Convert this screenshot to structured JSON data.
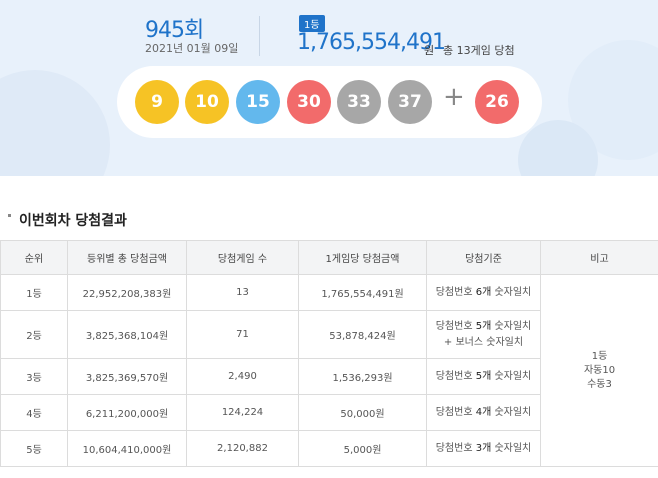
{
  "draw": {
    "round": "945회",
    "date": "2021년 01월 09일",
    "first_prize_badge": "1등",
    "first_prize_amount": "1,765,554,491",
    "first_prize_unit": "원",
    "winner_text": "총 13게임 당첨"
  },
  "balls": [
    {
      "number": "9",
      "color": "#f6c325"
    },
    {
      "number": "10",
      "color": "#f6c325"
    },
    {
      "number": "15",
      "color": "#63b8ed"
    },
    {
      "number": "30",
      "color": "#f26b6b"
    },
    {
      "number": "33",
      "color": "#a7a7a7"
    },
    {
      "number": "37",
      "color": "#a7a7a7"
    }
  ],
  "plus_sign": "+",
  "bonus_ball": {
    "number": "26",
    "color": "#f26b6b"
  },
  "section_title": "이번회차 당첨결과",
  "table": {
    "headers": [
      "순위",
      "등위별 총 당첨금액",
      "당첨게임 수",
      "1게임당 당첨금액",
      "당첨기준",
      "비고"
    ],
    "rows": [
      {
        "rank": "1등",
        "total": "22,952,208,383원",
        "games": "13",
        "per_game": "1,765,554,491원",
        "criteria_prefix": "당첨번호 ",
        "criteria_count": "6개",
        "criteria_suffix": " 숫자일치",
        "criteria_line2": ""
      },
      {
        "rank": "2등",
        "total": "3,825,368,104원",
        "games": "71",
        "per_game": "53,878,424원",
        "criteria_prefix": "당첨번호 ",
        "criteria_count": "5개",
        "criteria_suffix": " 숫자일치",
        "criteria_line2": "+ 보너스 숫자일치"
      },
      {
        "rank": "3등",
        "total": "3,825,369,570원",
        "games": "2,490",
        "per_game": "1,536,293원",
        "criteria_prefix": "당첨번호 ",
        "criteria_count": "5개",
        "criteria_suffix": " 숫자일치",
        "criteria_line2": ""
      },
      {
        "rank": "4등",
        "total": "6,211,200,000원",
        "games": "124,224",
        "per_game": "50,000원",
        "criteria_prefix": "당첨번호 ",
        "criteria_count": "4개",
        "criteria_suffix": " 숫자일치",
        "criteria_line2": ""
      },
      {
        "rank": "5등",
        "total": "10,604,410,000원",
        "games": "2,120,882",
        "per_game": "5,000원",
        "criteria_prefix": "당첨번호 ",
        "criteria_count": "3개",
        "criteria_suffix": " 숫자일치",
        "criteria_line2": ""
      }
    ],
    "note": {
      "line1": "1등",
      "line2": "자동10",
      "line3": "수동3"
    }
  }
}
